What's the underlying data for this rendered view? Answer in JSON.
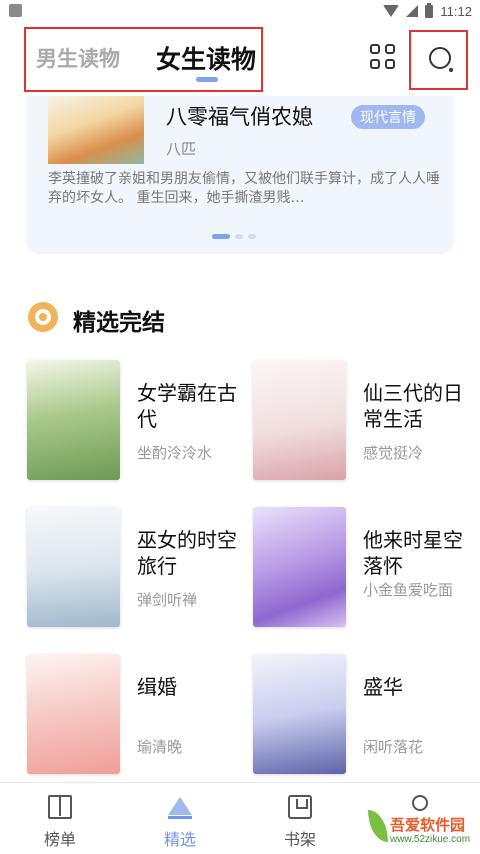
{
  "status_bar": {
    "time": "11:12"
  },
  "header": {
    "tabs": [
      {
        "label": "男生读物",
        "active": false
      },
      {
        "label": "女生读物",
        "active": true
      }
    ],
    "icons": [
      "grid-icon",
      "search-icon"
    ]
  },
  "banner": {
    "title": "八零福气俏农媳",
    "tag": "现代言情",
    "author": "八匹",
    "description": "李英撞破了亲姐和男朋友偷情，又被他们联手算计，成了人人唾弃的坏女人。 重生回来，她手撕渣男贱…",
    "page_index": 0,
    "page_count": 3
  },
  "section": {
    "title": "精选完结",
    "icon": "award-icon"
  },
  "books": [
    {
      "title": "女学霸在古代",
      "author": "坐酌泠泠水"
    },
    {
      "title": "仙三代的日常生活",
      "author": "感觉挺冷"
    },
    {
      "title": "巫女的时空旅行",
      "author": "弹剑听禅"
    },
    {
      "title": "他来时星空落怀",
      "author": "小金鱼爱吃面"
    },
    {
      "title": "缉婚",
      "author": "瑜清晚"
    },
    {
      "title": "盛华",
      "author": "闲听落花"
    }
  ],
  "bottom_nav": {
    "items": [
      {
        "label": "榜单",
        "icon": "book-icon",
        "active": false
      },
      {
        "label": "精选",
        "icon": "crown-icon",
        "active": true
      },
      {
        "label": "书架",
        "icon": "shelf-icon",
        "active": false
      },
      {
        "label": "",
        "icon": "user-icon",
        "active": false
      }
    ]
  },
  "watermark": {
    "text": "吾爱软件园",
    "url": "www.52zikue.com"
  },
  "colors": {
    "accent": "#6f95ee",
    "highlight_box": "#e03333",
    "banner_bg": "#f1f5fc",
    "section_icon": "#f0b45a"
  }
}
